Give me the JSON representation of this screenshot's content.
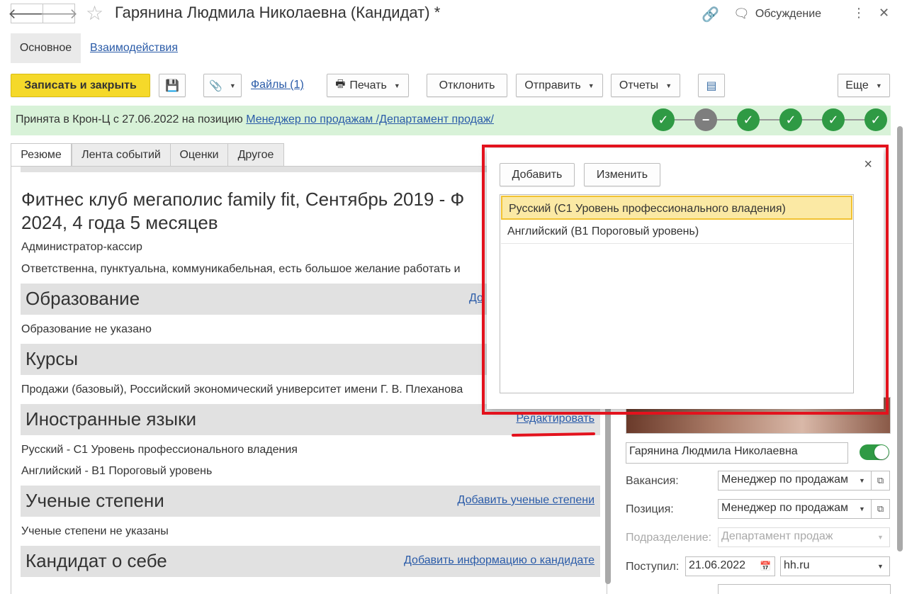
{
  "window": {
    "title": "Гарянина Людмила Николаевна (Кандидат) *",
    "discussion_label": "Обсуждение"
  },
  "sections_nav": {
    "main": "Основное",
    "interactions": "Взаимодействия"
  },
  "toolbar": {
    "save_close": "Записать и закрыть",
    "files": "Файлы (1)",
    "print": "Печать",
    "reject": "Отклонить",
    "send": "Отправить",
    "reports": "Отчеты",
    "more": "Еще"
  },
  "status": {
    "text": "Принята в Крон-Ц с 27.06.2022 на позицию ",
    "link": "Менеджер по продажам /Департамент продаж/",
    "steps": [
      "done",
      "skipped",
      "done",
      "done",
      "done",
      "done"
    ]
  },
  "tabs": [
    "Резюме",
    "Лента событий",
    "Оценки",
    "Другое"
  ],
  "resume": {
    "job_title_line1": "Фитнес клуб мегаполис family fit, Сентябрь 2019 - Ф",
    "job_title_line2": "2024, 4 года 5 месяцев",
    "position": "Администратор-кассир",
    "description": "Ответственна, пунктуальна, коммуникабельная, есть большое желание работать и",
    "education": {
      "title": "Образование",
      "link": "До",
      "text": "Образование не указано"
    },
    "courses": {
      "title": "Курсы",
      "text": "Продажи (базовый), Российский экономический университет имени Г. В. Плеханова"
    },
    "languages": {
      "title": "Иностранные языки",
      "link": "Редактировать",
      "items": [
        "Русский - С1 Уровень профессионального владения",
        "Английский - В1 Пороговый уровень"
      ]
    },
    "degrees": {
      "title": "Ученые степени",
      "link": "Добавить ученые степени",
      "text": "Ученые степени не указаны"
    },
    "about": {
      "title": "Кандидат о себе",
      "link": "Добавить информацию о кандидате"
    }
  },
  "right_panel": {
    "full_name": "Гарянина Людмила Николаевна",
    "vacancy_label": "Вакансия:",
    "vacancy_value": "Менеджер по продажам",
    "position_label": "Позиция:",
    "position_value": "Менеджер по продажам",
    "department_label": "Подразделение:",
    "department_value": "Департамент продаж",
    "received_label": "Поступил:",
    "received_date": "21.06.2022",
    "source": "hh.ru"
  },
  "popup": {
    "add": "Добавить",
    "edit": "Изменить",
    "rows": [
      "Русский (С1 Уровень профессионального владения)",
      "Английский (В1 Пороговый уровень)"
    ],
    "selected_index": 0
  },
  "colors": {
    "accent_yellow": "#f5d92a",
    "link_blue": "#2a5ba8",
    "status_green_bg": "#d8f2d8",
    "step_green": "#2f9a44",
    "highlight_red": "#e3121d"
  }
}
